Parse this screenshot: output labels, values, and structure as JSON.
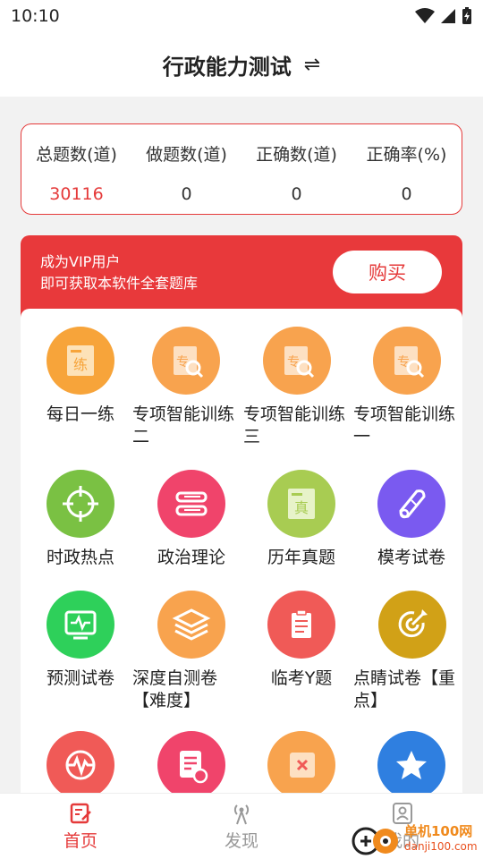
{
  "status_bar": {
    "time": "10:10"
  },
  "header": {
    "title": "行政能力测试",
    "switch_icon": "⇌"
  },
  "stats": [
    {
      "label": "总题数(道)",
      "value": "30116"
    },
    {
      "label": "做题数(道)",
      "value": "0"
    },
    {
      "label": "正确数(道)",
      "value": "0"
    },
    {
      "label": "正确率(%)",
      "value": "0"
    }
  ],
  "vip": {
    "line1": "成为VIP用户",
    "line2": "即可获取本软件全套题库",
    "buy_label": "购买"
  },
  "grid": [
    {
      "label": "每日一练",
      "icon": "practice-icon",
      "color": "#f7a43a"
    },
    {
      "label": "专项智能训练二",
      "icon": "special-search-icon",
      "color": "#f8a34e"
    },
    {
      "label": "专项智能训练三",
      "icon": "special-search-icon",
      "color": "#f8a34e"
    },
    {
      "label": "专项智能训练一",
      "icon": "special-search-icon",
      "color": "#f8a34e"
    },
    {
      "label": "时政热点",
      "icon": "crosshair-icon",
      "color": "#7ac143"
    },
    {
      "label": "政治理论",
      "icon": "books-icon",
      "color": "#f0446b"
    },
    {
      "label": "历年真题",
      "icon": "real-exam-icon",
      "color": "#a8cc52"
    },
    {
      "label": "模考试卷",
      "icon": "scroll-icon",
      "color": "#7a5af0"
    },
    {
      "label": "预测试卷",
      "icon": "monitor-pulse-icon",
      "color": "#2ed05a"
    },
    {
      "label": "深度自测卷【难度】",
      "icon": "layers-icon",
      "color": "#f8a34e"
    },
    {
      "label": "临考Y题",
      "icon": "clipboard-icon",
      "color": "#f05a57"
    },
    {
      "label": "点睛试卷【重点】",
      "icon": "target-icon",
      "color": "#d1a117"
    },
    {
      "label": "",
      "icon": "heartbeat-icon",
      "color": "#f05a57"
    },
    {
      "label": "",
      "icon": "doc-clock-icon",
      "color": "#f0446b"
    },
    {
      "label": "",
      "icon": "wrong-book-icon",
      "color": "#f8a34e"
    },
    {
      "label": "",
      "icon": "star-icon",
      "color": "#2f7fe0"
    }
  ],
  "bottom_nav": [
    {
      "label": "首页",
      "icon": "home-edit-icon"
    },
    {
      "label": "发现",
      "icon": "broadcast-icon"
    },
    {
      "label": "我的",
      "icon": "profile-icon"
    }
  ],
  "watermark": {
    "cn": "单机100网",
    "en": "danji100.com"
  },
  "colors": {
    "accent": "#e53a3a",
    "nav_inactive": "#999999"
  }
}
